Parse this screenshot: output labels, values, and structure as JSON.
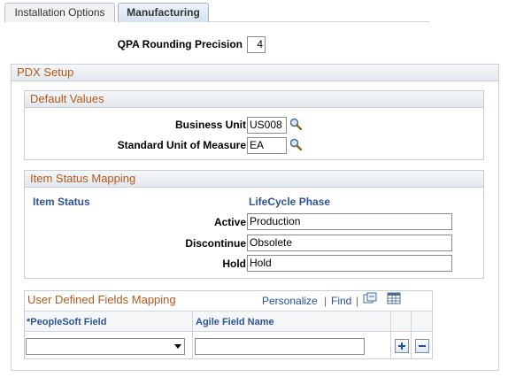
{
  "tabs": [
    {
      "label": "Installation Options",
      "active": false
    },
    {
      "label": "Manufacturing",
      "active": true
    }
  ],
  "qpa": {
    "label": "QPA Rounding Precision",
    "value": "4"
  },
  "pdx_setup": {
    "title": "PDX Setup",
    "default_values": {
      "title": "Default Values",
      "business_unit": {
        "label": "Business Unit",
        "value": "US008"
      },
      "uom": {
        "label": "Standard Unit of Measure",
        "value": "EA"
      }
    },
    "item_status_mapping": {
      "title": "Item Status Mapping",
      "col_item_status": "Item Status",
      "col_lifecycle": "LifeCycle Phase",
      "rows": [
        {
          "label": "Active",
          "value": "Production"
        },
        {
          "label": "Discontinue",
          "value": "Obsolete"
        },
        {
          "label": "Hold",
          "value": "Hold"
        }
      ]
    },
    "udf_mapping": {
      "title": "User Defined Fields Mapping",
      "personalize": "Personalize",
      "pipe": "|",
      "find": "Find",
      "pipe2": "|",
      "col_peoplesoft": "*PeopleSoft Field",
      "col_agile": "Agile Field Name",
      "row": {
        "peoplesoft_value": "",
        "agile_value": ""
      }
    }
  },
  "colors": {
    "group_title": "#b2591d",
    "column_header": "#2f5496",
    "link": "#1f4e9c"
  },
  "icons": [
    "lookup-icon",
    "view-all-icon",
    "download-grid-icon",
    "add-row-icon",
    "delete-row-icon",
    "dropdown-arrow-icon"
  ]
}
